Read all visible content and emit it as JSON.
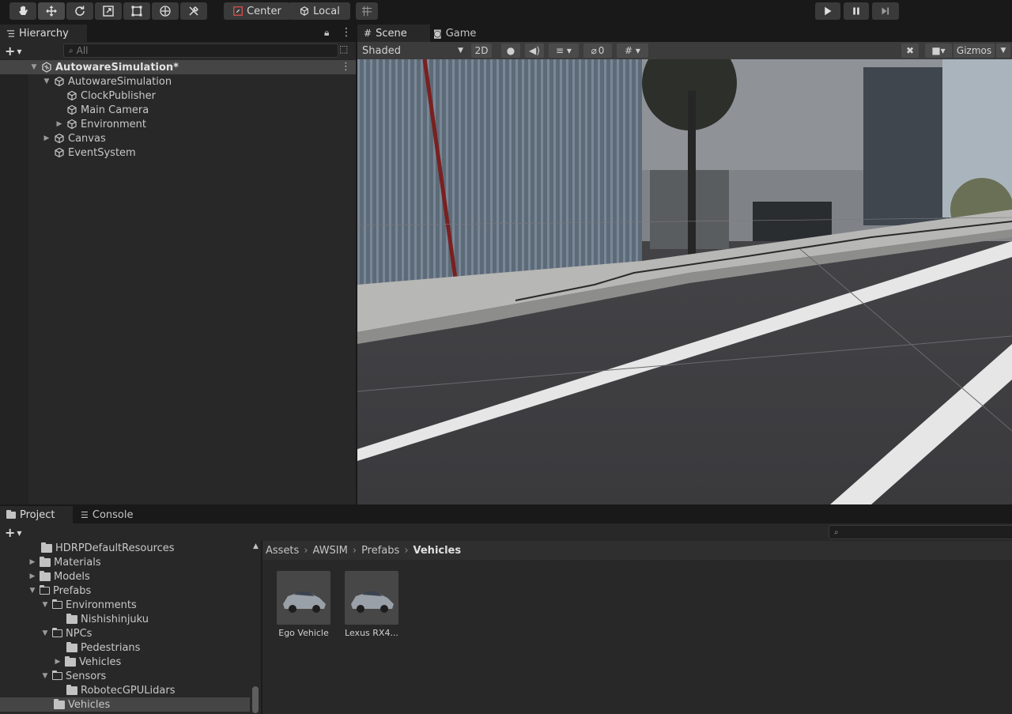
{
  "toolbar": {
    "tools": [
      {
        "name": "hand-tool",
        "icon": "hand-icon"
      },
      {
        "name": "move-tool",
        "icon": "move-icon"
      },
      {
        "name": "rotate-tool",
        "icon": "rotate-icon"
      },
      {
        "name": "scale-tool",
        "icon": "scale-icon"
      },
      {
        "name": "rect-tool",
        "icon": "rect-icon"
      },
      {
        "name": "transform-tool",
        "icon": "transform-icon"
      },
      {
        "name": "custom-tool",
        "icon": "tools-icon"
      }
    ],
    "pivot_label": "Center",
    "space_label": "Local",
    "play_icon": "play-icon",
    "pause_icon": "pause-icon",
    "step_icon": "step-icon"
  },
  "hierarchy": {
    "tab_label": "Hierarchy",
    "search_placeholder": "All",
    "scene_name": "AutowareSimulation*",
    "items": [
      {
        "label": "AutowareSimulation",
        "depth": 1,
        "expanded": true
      },
      {
        "label": "ClockPublisher",
        "depth": 2
      },
      {
        "label": "Main Camera",
        "depth": 2
      },
      {
        "label": "Environment",
        "depth": 2,
        "expandable": true
      },
      {
        "label": "Canvas",
        "depth": 1,
        "expandable": true
      },
      {
        "label": "EventSystem",
        "depth": 1
      }
    ]
  },
  "scene_view": {
    "tabs": [
      "Scene",
      "Game"
    ],
    "shading_mode": "Shaded",
    "mode_2d": "2D",
    "hidden_count": "0",
    "gizmos_label": "Gizmos"
  },
  "project": {
    "tabs": [
      "Project",
      "Console"
    ],
    "tree": [
      {
        "label": "HDRPDefaultResources",
        "depth": 0
      },
      {
        "label": "Materials",
        "depth": 0,
        "expandable": true
      },
      {
        "label": "Models",
        "depth": 0,
        "expandable": true
      },
      {
        "label": "Prefabs",
        "depth": 0,
        "expanded": true
      },
      {
        "label": "Environments",
        "depth": 1,
        "expanded": true
      },
      {
        "label": "Nishishinjuku",
        "depth": 2
      },
      {
        "label": "NPCs",
        "depth": 1,
        "expanded": true
      },
      {
        "label": "Pedestrians",
        "depth": 2
      },
      {
        "label": "Vehicles",
        "depth": 2,
        "expandable": true
      },
      {
        "label": "Sensors",
        "depth": 1,
        "expanded": true
      },
      {
        "label": "RobotecGPULidars",
        "depth": 2
      },
      {
        "label": "Vehicles",
        "depth": 1,
        "selected": true
      }
    ],
    "breadcrumb": [
      "Assets",
      "AWSIM",
      "Prefabs",
      "Vehicles"
    ],
    "assets": [
      {
        "label": "Ego Vehicle"
      },
      {
        "label": "Lexus RX4..."
      }
    ]
  }
}
